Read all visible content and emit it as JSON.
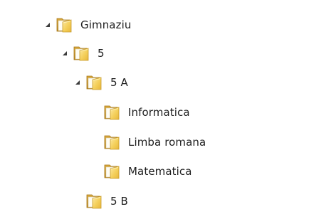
{
  "tree": {
    "nodes": [
      {
        "id": "gimnaziu",
        "label": "Gimnaziu",
        "expanded": true,
        "icon": "folder-icon"
      },
      {
        "id": "5",
        "label": "5",
        "expanded": true,
        "icon": "folder-icon"
      },
      {
        "id": "5a",
        "label": "5 A",
        "expanded": true,
        "icon": "folder-icon"
      },
      {
        "id": "informatica",
        "label": "Informatica",
        "icon": "folder-icon"
      },
      {
        "id": "limba-romana",
        "label": "Limba romana",
        "icon": "folder-icon"
      },
      {
        "id": "matematica",
        "label": "Matematica",
        "icon": "folder-icon"
      },
      {
        "id": "5b",
        "label": "5 B",
        "icon": "folder-icon"
      }
    ]
  },
  "colors": {
    "folder_back": "#c9962d",
    "folder_front": "#f4cf5a",
    "folder_front_light": "#fbe493",
    "folder_edge": "#b88620",
    "expander": "#3b3b3b",
    "text": "#1e1e1e",
    "background": "#ffffff"
  }
}
